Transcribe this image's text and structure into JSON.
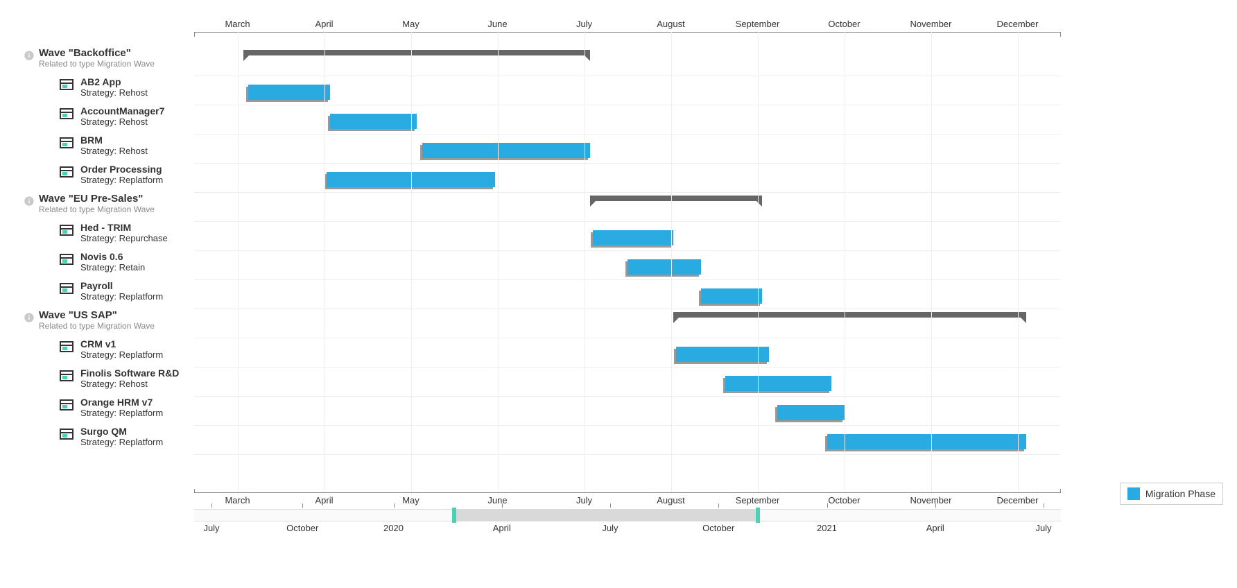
{
  "chart_data": {
    "type": "gantt",
    "title": "",
    "xlabel": "",
    "ylabel": "",
    "x_axis_months": [
      "March",
      "April",
      "May",
      "June",
      "July",
      "August",
      "September",
      "October",
      "November",
      "December"
    ],
    "month_positions_pct": [
      5,
      15,
      25,
      35,
      45,
      55,
      65,
      75,
      85,
      95
    ],
    "legend": {
      "label": "Migration Phase",
      "color": "#29abe2"
    },
    "groups": [
      {
        "title": "Wave \"Backoffice\"",
        "subtitle": "Related to type Migration Wave",
        "span_start_pct": 5.7,
        "span_end_pct": 45.7,
        "items": [
          {
            "name": "AB2 App",
            "strategy": "Rehost",
            "start_pct": 6.2,
            "end_pct": 15.7
          },
          {
            "name": "AccountManager7",
            "strategy": "Rehost",
            "start_pct": 15.7,
            "end_pct": 25.7
          },
          {
            "name": "BRM",
            "strategy": "Rehost",
            "start_pct": 26.3,
            "end_pct": 45.7
          },
          {
            "name": "Order Processing",
            "strategy": "Replatform",
            "start_pct": 15.3,
            "end_pct": 34.7
          }
        ]
      },
      {
        "title": "Wave \"EU Pre-Sales\"",
        "subtitle": "Related to type Migration Wave",
        "span_start_pct": 45.7,
        "span_end_pct": 65.5,
        "items": [
          {
            "name": "Hed - TRIM",
            "strategy": "Repurchase",
            "start_pct": 46.0,
            "end_pct": 55.3
          },
          {
            "name": "Novis 0.6",
            "strategy": "Retain",
            "start_pct": 50.0,
            "end_pct": 58.5
          },
          {
            "name": "Payroll",
            "strategy": "Replatform",
            "start_pct": 58.5,
            "end_pct": 65.5
          }
        ]
      },
      {
        "title": "Wave \"US SAP\"",
        "subtitle": "Related to type Migration Wave",
        "span_start_pct": 55.3,
        "span_end_pct": 96.0,
        "items": [
          {
            "name": "CRM v1",
            "strategy": "Replatform",
            "start_pct": 55.6,
            "end_pct": 66.3
          },
          {
            "name": "Finolis Software R&D",
            "strategy": "Rehost",
            "start_pct": 61.3,
            "end_pct": 73.5
          },
          {
            "name": "Orange HRM v7",
            "strategy": "Replatform",
            "start_pct": 67.3,
            "end_pct": 75.0
          },
          {
            "name": "Surgo QM",
            "strategy": "Replatform",
            "start_pct": 73.0,
            "end_pct": 96.0
          }
        ]
      }
    ],
    "overview_axis": {
      "labels": [
        "July",
        "October",
        "2020",
        "April",
        "July",
        "October",
        "2021",
        "April",
        "July"
      ],
      "positions_pct": [
        2,
        12.5,
        23,
        35.5,
        48,
        60.5,
        73,
        85.5,
        98
      ],
      "selection_start_pct": 30,
      "selection_end_pct": 65
    }
  }
}
